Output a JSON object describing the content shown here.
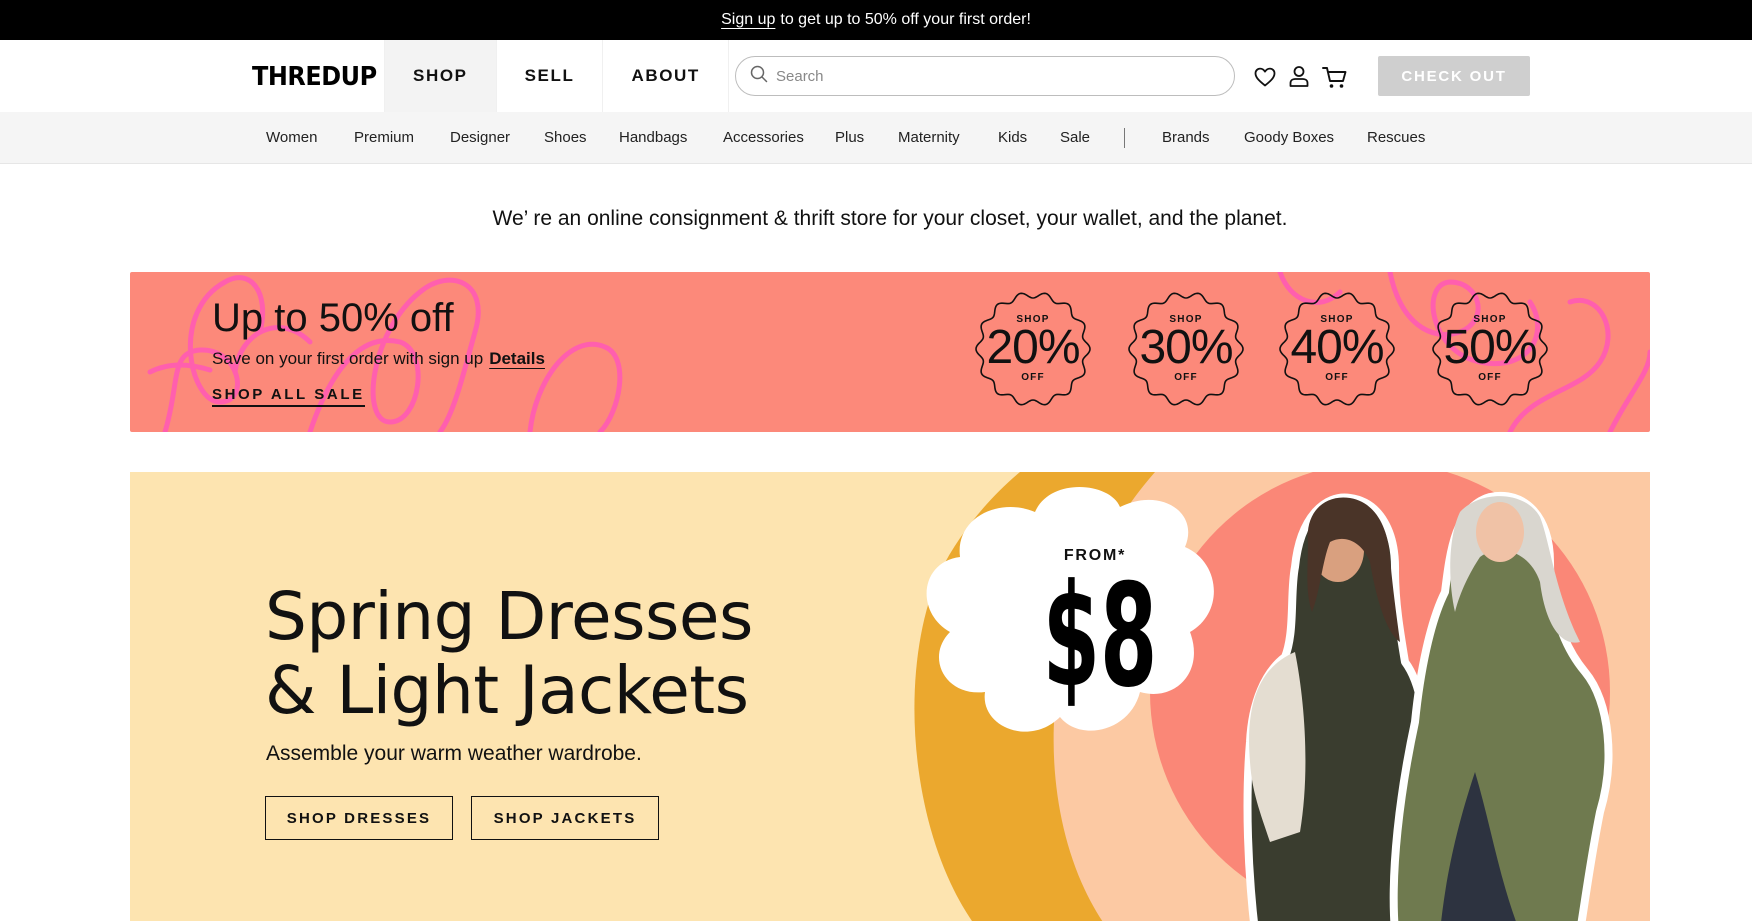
{
  "promo": {
    "link": "Sign up",
    "text": "to get up to 50% off your first order!"
  },
  "header": {
    "logo": "THREDUP",
    "nav": [
      {
        "label": "SHOP",
        "active": true
      },
      {
        "label": "SELL",
        "active": false
      },
      {
        "label": "ABOUT",
        "active": false
      }
    ],
    "search_placeholder": "Search",
    "icons": [
      "heart-icon",
      "user-icon",
      "cart-icon"
    ],
    "checkout_label": "CHECK OUT"
  },
  "categories": {
    "primary": [
      "Women",
      "Premium",
      "Designer",
      "Shoes",
      "Handbags",
      "Accessories",
      "Plus",
      "Maternity",
      "Kids",
      "Sale"
    ],
    "secondary": [
      "Brands",
      "Goody Boxes",
      "Rescues"
    ]
  },
  "tagline": "We’   re an online consignment & thrift store for your closet, your wallet, and the planet.",
  "sale_banner": {
    "title": "Up to 50% off",
    "subtitle": "Save on your first order with sign up",
    "details_link": "Details",
    "shop_all": "SHOP ALL SALE",
    "badges": [
      {
        "top": "SHOP",
        "value": "20%",
        "bottom": "OFF"
      },
      {
        "top": "SHOP",
        "value": "30%",
        "bottom": "OFF"
      },
      {
        "top": "SHOP",
        "value": "40%",
        "bottom": "OFF"
      },
      {
        "top": "SHOP",
        "value": "50%",
        "bottom": "OFF"
      }
    ],
    "colors": {
      "background": "#fc897a",
      "squiggle": "#ff5fae"
    }
  },
  "hero": {
    "title_line1": "Spring Dresses",
    "title_line2": "& Light Jackets",
    "subtitle": "Assemble your warm weather wardrobe.",
    "buttons": [
      "SHOP DRESSES",
      "SHOP JACKETS"
    ],
    "price_from": "FROM*",
    "price": "$8",
    "colors": {
      "background": "#fde4b0",
      "arc": "#eba82e",
      "peach": "#fcc9a3",
      "coral": "#fa8777"
    }
  }
}
